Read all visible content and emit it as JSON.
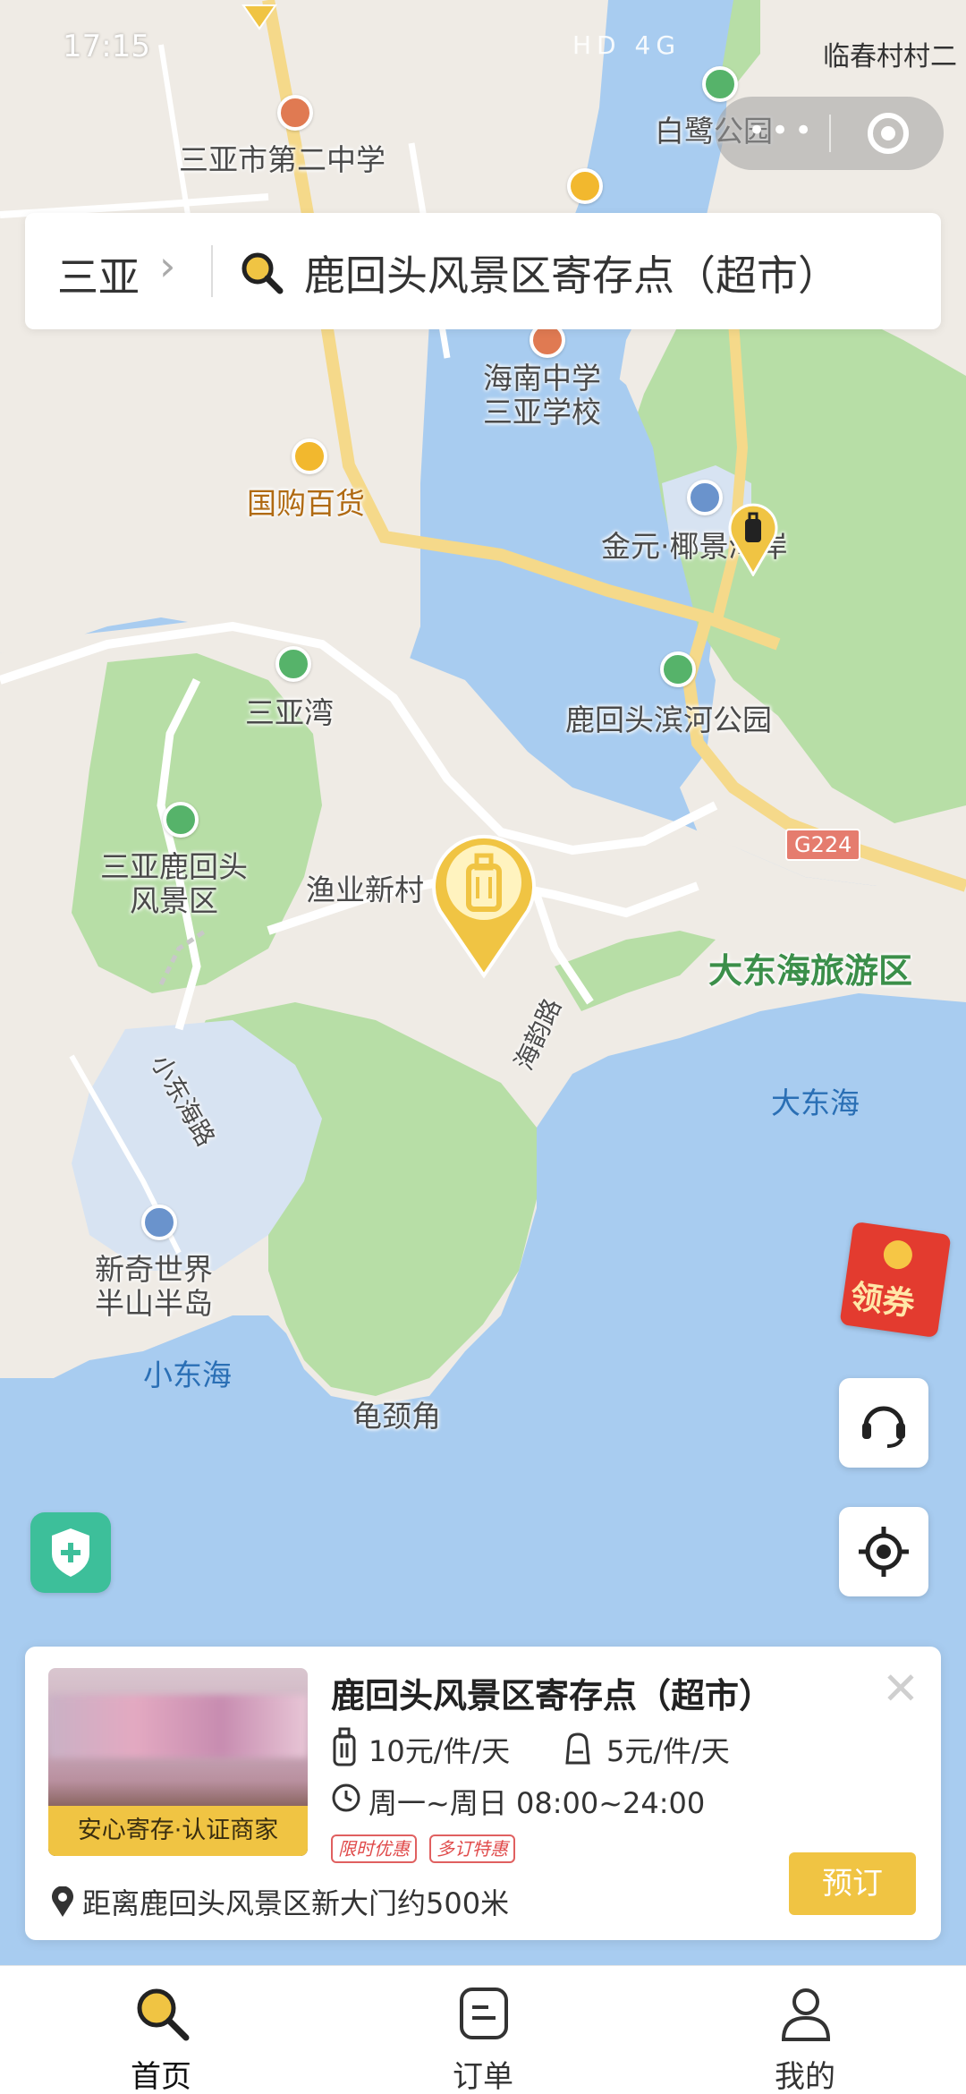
{
  "status_bar": {
    "time": "17:15",
    "carrier": "临春村村二",
    "icons": "HD 4G"
  },
  "search": {
    "city": "三亚",
    "query": "鹿回头风景区寄存点（超市）"
  },
  "map": {
    "labels": {
      "sanya_no2_school": "三亚市第二中学",
      "bailu_park": "白鹭公园",
      "hainan_middle_school": "海南中学\n三亚学校",
      "guogou": "国购百货",
      "jinyuan": "金元·椰景湾岸",
      "sanya_bay": "三亚湾",
      "luhuitou_river_park": "鹿回头滨河公园",
      "luhuitou_scenic": "三亚鹿回头\n风景区",
      "yuye_village": "渔业新村",
      "road_g224": "G224",
      "dadonghai_area": "大东海旅游区",
      "haiyun_road": "海韵路",
      "dadonghai": "大东海",
      "xiaodonghai_road": "小东海路",
      "xinqi_world": "新奇世界\n半山半岛",
      "xiaodonghai": "小东海",
      "guijing_cape": "龟颈角"
    }
  },
  "floating": {
    "coupon_label": "领券"
  },
  "card": {
    "title": "鹿回头风景区寄存点（超市）",
    "badge": "安心寄存·认证商家",
    "price_luggage": "10元/件/天",
    "price_bag": "5元/件/天",
    "hours": "周一~周日 08:00~24:00",
    "tags": [
      "限时优惠",
      "多订特惠"
    ],
    "distance": "距离鹿回头风景区新大门约500米",
    "book_label": "预订"
  },
  "tabbar": {
    "home": "首页",
    "orders": "订单",
    "mine": "我的"
  },
  "colors": {
    "accent": "#F0C443",
    "water": "#A8CCF0",
    "park": "#B7DEA6",
    "tag_red": "#E04A4A"
  }
}
